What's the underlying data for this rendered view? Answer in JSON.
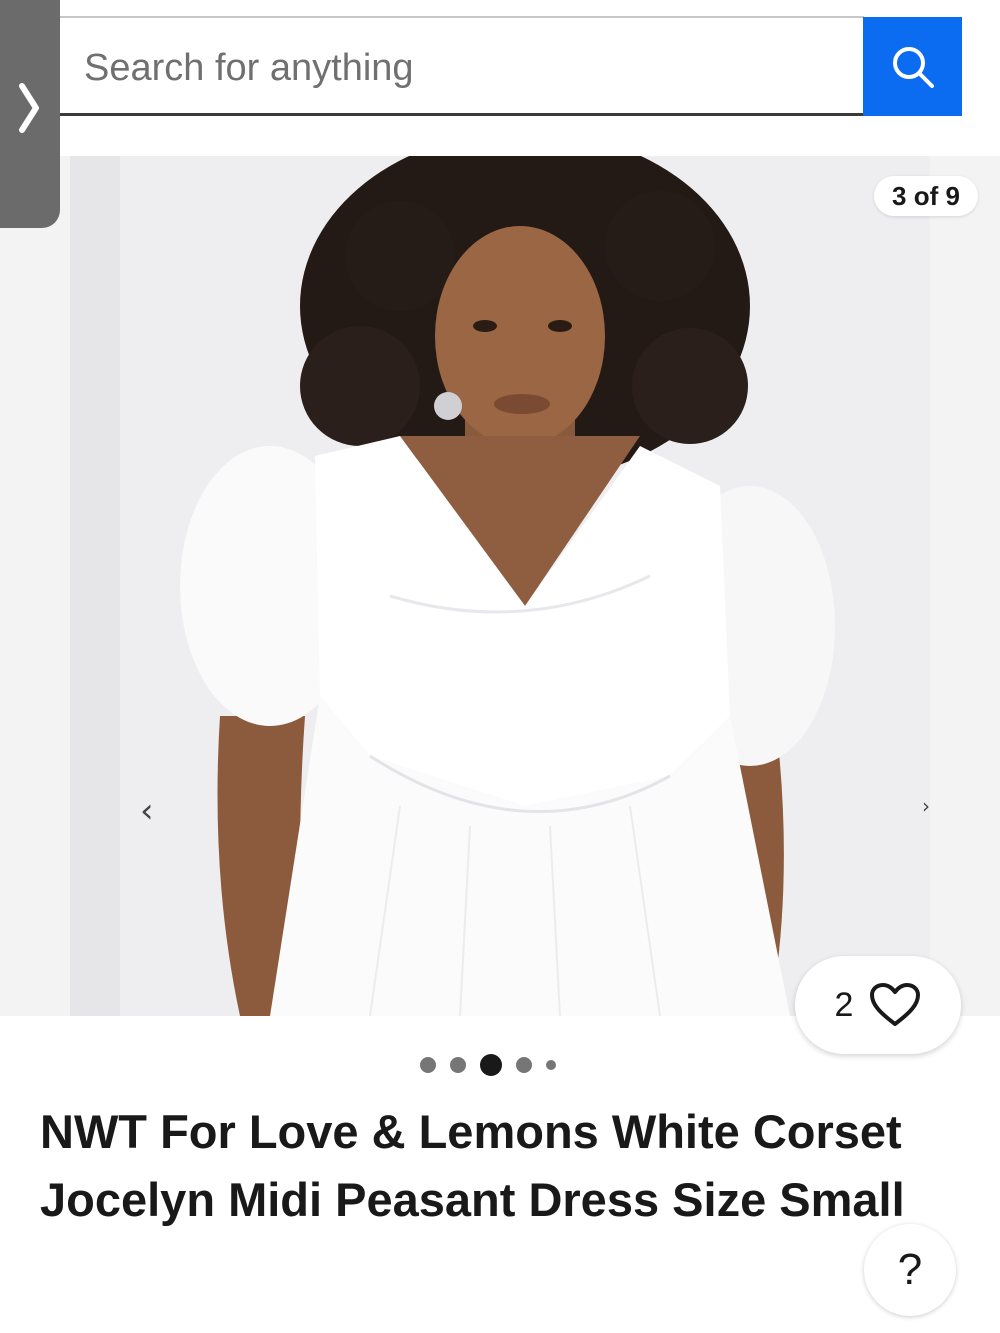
{
  "search": {
    "placeholder": "Search for anything",
    "button_icon": "search-icon"
  },
  "side_panel": {
    "icon": "chevron-right-icon"
  },
  "gallery": {
    "counter": "3 of 9",
    "current_index": 3,
    "total": 9,
    "prev_arrow": "‹",
    "next_arrow": "›",
    "image_description_icon": "product-photo"
  },
  "watch": {
    "count": "2",
    "icon": "heart-icon"
  },
  "pagination_dots": {
    "count": 5,
    "active_index": 2
  },
  "listing": {
    "title": "NWT For Love & Lemons White Corset Jocelyn Midi Peasant Dress Size Small"
  },
  "help": {
    "label": "?"
  },
  "colors": {
    "accent": "#0b6cf2",
    "text": "#191919",
    "side_tab": "#6b6b6b"
  }
}
